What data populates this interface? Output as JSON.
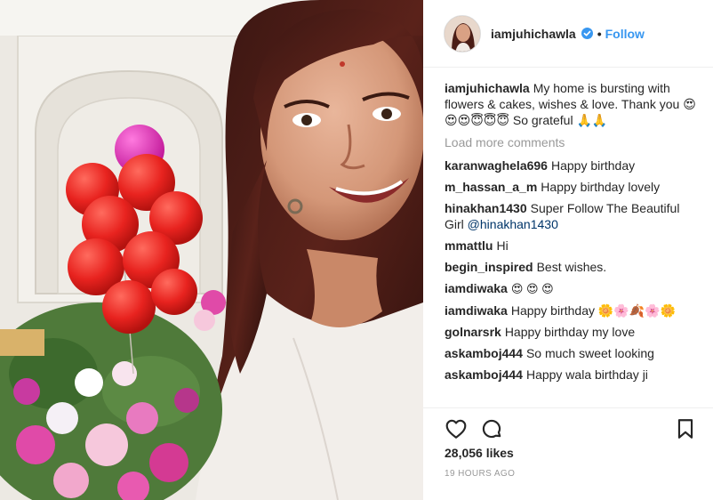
{
  "post": {
    "username": "iamjuhichawla",
    "follow_label": "Follow",
    "separator": "•",
    "caption": {
      "user": "iamjuhichawla",
      "text": "My home is bursting with flowers & cakes, wishes & love. Thank you 😍😍😍😇😇😇 So grateful 🙏🙏"
    },
    "load_more_label": "Load more comments",
    "comments": [
      {
        "user": "karanwaghela696",
        "text": "Happy birthday"
      },
      {
        "user": "m_hassan_a_m",
        "text": "Happy birthday lovely"
      },
      {
        "user": "hinakhan1430",
        "text": "Super Follow The Beautiful Girl",
        "mention": "@hinakhan1430"
      },
      {
        "user": "mmattlu",
        "text": "Hi"
      },
      {
        "user": "begin_inspired",
        "text": "Best wishes."
      },
      {
        "user": "iamdiwaka",
        "text": "😍 😍 😍"
      },
      {
        "user": "iamdiwaka",
        "text": "Happy birthday 🌼🌸🍂🌸🌼"
      },
      {
        "user": "golnarsrk",
        "text": "Happy birthday my love"
      },
      {
        "user": "askamboj444",
        "text": "So much sweet looking"
      },
      {
        "user": "askamboj444",
        "text": "Happy wala birthday ji"
      }
    ],
    "likes": "28,056 likes",
    "timestamp": "19 HOURS AGO"
  },
  "icons": {
    "verified": "verified-badge-icon",
    "like": "heart-icon",
    "comment": "comment-bubble-icon",
    "save": "bookmark-icon"
  },
  "colors": {
    "link_blue": "#3897f0",
    "muted_gray": "#999999",
    "text": "#262626",
    "mention": "#003569"
  }
}
